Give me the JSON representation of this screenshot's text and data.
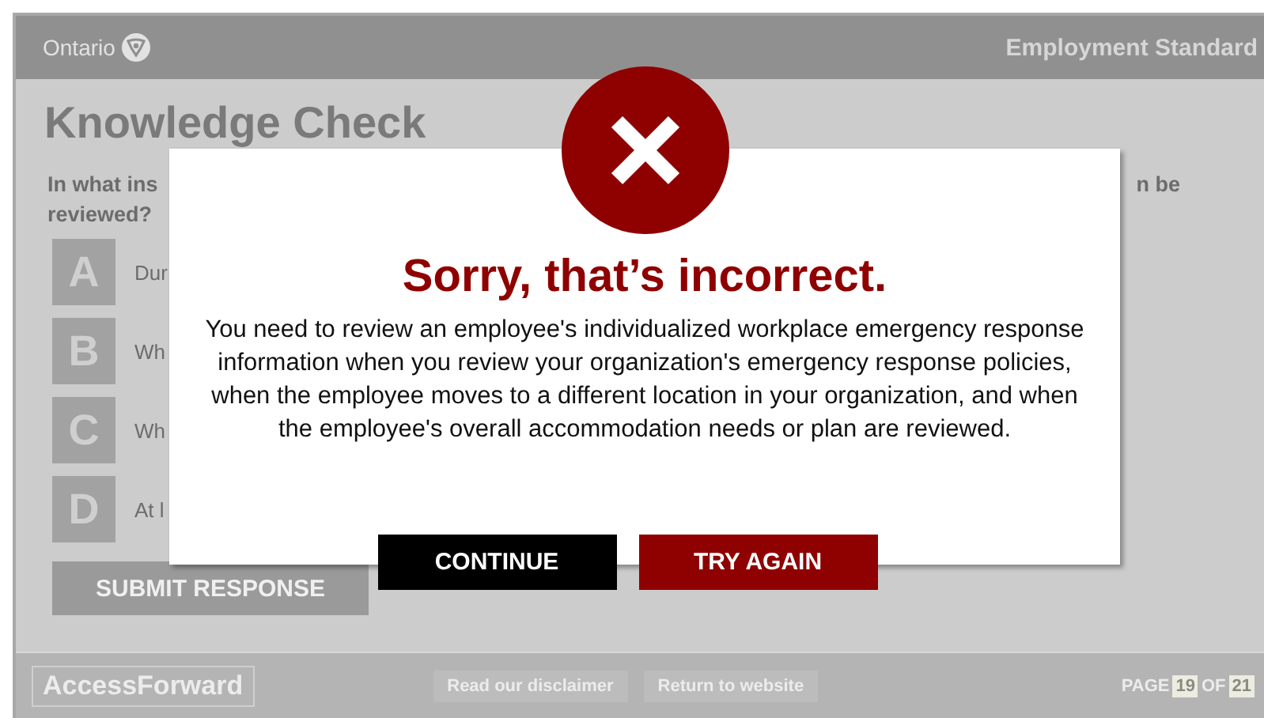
{
  "header": {
    "brand": "Ontario",
    "course_title": "Employment Standard"
  },
  "page": {
    "title": "Knowledge Check",
    "question_start": "In what ins",
    "question_end": "n be",
    "question_line_2": "reviewed?",
    "options": [
      {
        "letter": "A",
        "text": "Dur"
      },
      {
        "letter": "B",
        "text": "Wh"
      },
      {
        "letter": "C",
        "text": "Wh"
      },
      {
        "letter": "D",
        "text": "At l"
      }
    ],
    "submit_button": "SUBMIT RESPONSE"
  },
  "dialog": {
    "title": "Sorry, that’s incorrect.",
    "message": "You need to review an employee's individualized workplace emergency response information when you review your organization's emergency response policies, when the employee moves to a different location in your organization, and when the employee's overall accommodation needs or plan are reviewed.",
    "buttons": [
      {
        "label": "CONTINUE",
        "kind": "secondary"
      },
      {
        "label": "TRY AGAIN",
        "kind": "primary"
      }
    ]
  },
  "footer": {
    "logo": "AccessForward",
    "links": [
      "Read our disclaimer",
      "Return to website"
    ],
    "page_label": "PAGE",
    "current_page": "19",
    "of_label": "OF",
    "total_pages": "21"
  }
}
